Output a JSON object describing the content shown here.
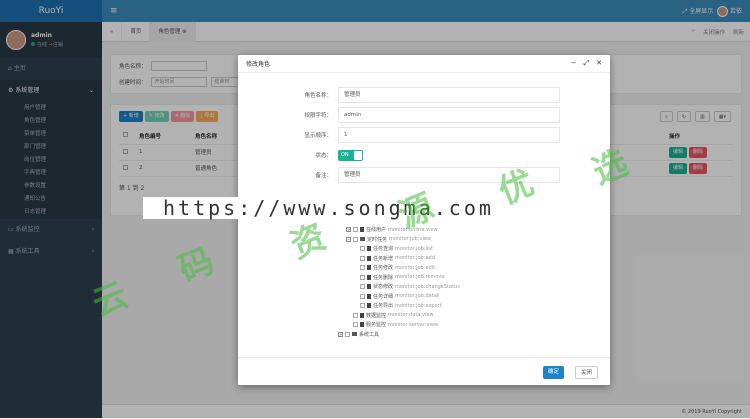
{
  "app": {
    "logo": "RuoYi",
    "fullscreen": "全屏显示",
    "user": "若依",
    "menu_icon": "hamburger-icon"
  },
  "profile": {
    "name": "admin",
    "status": "在线",
    "logout": "注销"
  },
  "sidebar": {
    "items": [
      {
        "label": "主页",
        "icon": "home-icon"
      },
      {
        "label": "系统管理",
        "icon": "gear-icon",
        "sub": [
          "用户管理",
          "角色管理",
          "菜单管理",
          "部门管理",
          "岗位管理",
          "字典管理",
          "参数设置",
          "通知公告",
          "日志管理"
        ]
      },
      {
        "label": "系统监控",
        "icon": "monitor-icon"
      },
      {
        "label": "系统工具",
        "icon": "tool-icon"
      }
    ]
  },
  "tabs": {
    "items": [
      "首页",
      "角色管理"
    ],
    "close_ops": "关闭操作",
    "refresh": "刷新"
  },
  "search": {
    "role_name_label": "角色名称：",
    "created_label": "创建时间：",
    "start_placeholder": "开始时间",
    "end_placeholder": "结束时"
  },
  "toolbar": {
    "add": "新增",
    "edit": "修改",
    "del": "删除",
    "export": "导出"
  },
  "table": {
    "headers": [
      "角色编号",
      "角色名称",
      "操作"
    ],
    "rows": [
      {
        "id": "1",
        "name": "管理员"
      },
      {
        "id": "2",
        "name": "普通角色"
      }
    ],
    "row_actions": [
      "编辑",
      "删除"
    ],
    "pager": "第 1 到 2"
  },
  "footer": "© 2019 RuoYi Copyright",
  "modal": {
    "title": "修改角色",
    "fields": [
      {
        "label": "角色名称：",
        "value": "管理员"
      },
      {
        "label": "权限字符：",
        "value": "admin"
      },
      {
        "label": "显示顺序：",
        "value": "1"
      }
    ],
    "status_label": "状态：",
    "status_toggle": "ON",
    "remark_label": "备注：",
    "remark_value": "管理员",
    "tree": [
      {
        "level": 0,
        "name": "在线用户",
        "perm": "monitor:online:view",
        "toggle": "+"
      },
      {
        "level": 0,
        "name": "定时任务",
        "perm": "monitor:job:view",
        "toggle": "−"
      },
      {
        "level": 1,
        "name": "任务查询",
        "perm": "monitor:job:list"
      },
      {
        "level": 1,
        "name": "任务新增",
        "perm": "monitor:job:add"
      },
      {
        "level": 1,
        "name": "任务修改",
        "perm": "monitor:job:edit"
      },
      {
        "level": 1,
        "name": "任务删除",
        "perm": "monitor:job:remove"
      },
      {
        "level": 1,
        "name": "状态修改",
        "perm": "monitor:job:changeStatus"
      },
      {
        "level": 1,
        "name": "任务详细",
        "perm": "monitor:job:detail"
      },
      {
        "level": 1,
        "name": "任务导出",
        "perm": "monitor:job:export"
      },
      {
        "level": 0,
        "name": "数据监控",
        "perm": "monitor:data:view"
      },
      {
        "level": 0,
        "name": "服务监控",
        "perm": "monitor:server:view"
      },
      {
        "level": -1,
        "name": "系统工具",
        "perm": "",
        "toggle": "+"
      }
    ],
    "confirm": "确定",
    "close": "关闭"
  },
  "watermark": {
    "url": "https://www.songma.com",
    "chars": [
      "云",
      "码",
      "资",
      "源",
      "优",
      "选"
    ]
  }
}
